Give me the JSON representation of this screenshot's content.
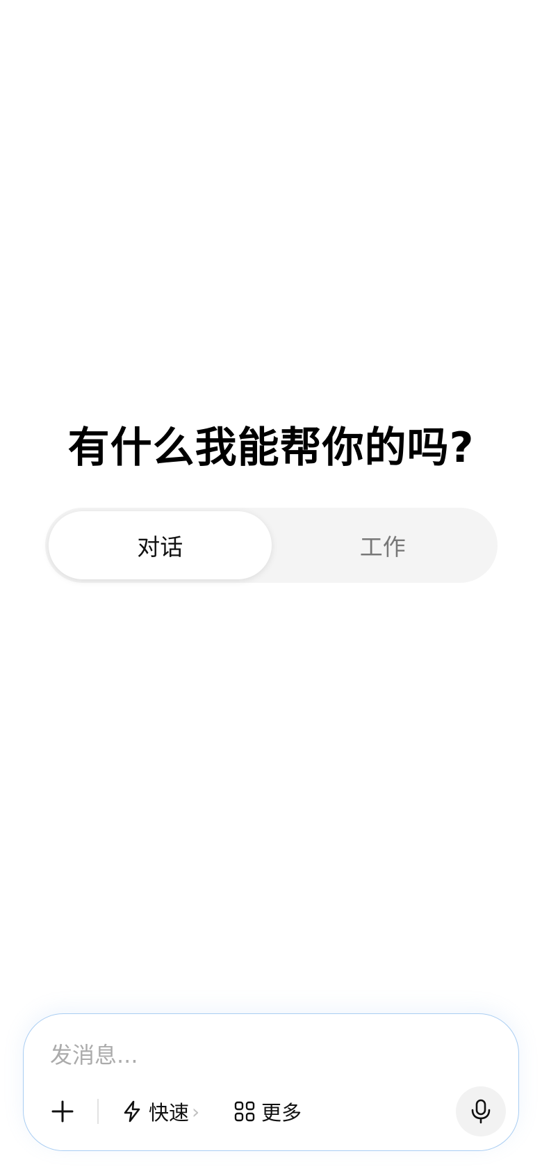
{
  "main": {
    "greeting": "有什么我能帮你的吗?",
    "mode_tabs": [
      {
        "label": "对话",
        "active": true
      },
      {
        "label": "工作",
        "active": false
      }
    ]
  },
  "composer": {
    "placeholder": "发消息...",
    "quick_label": "快速",
    "quick_chevron": "›",
    "more_label": "更多",
    "icons": {
      "add": "plus-icon",
      "quick": "lightning-icon",
      "more": "grid-icon",
      "voice": "microphone-icon"
    },
    "border_color": "#a9cdf2"
  }
}
